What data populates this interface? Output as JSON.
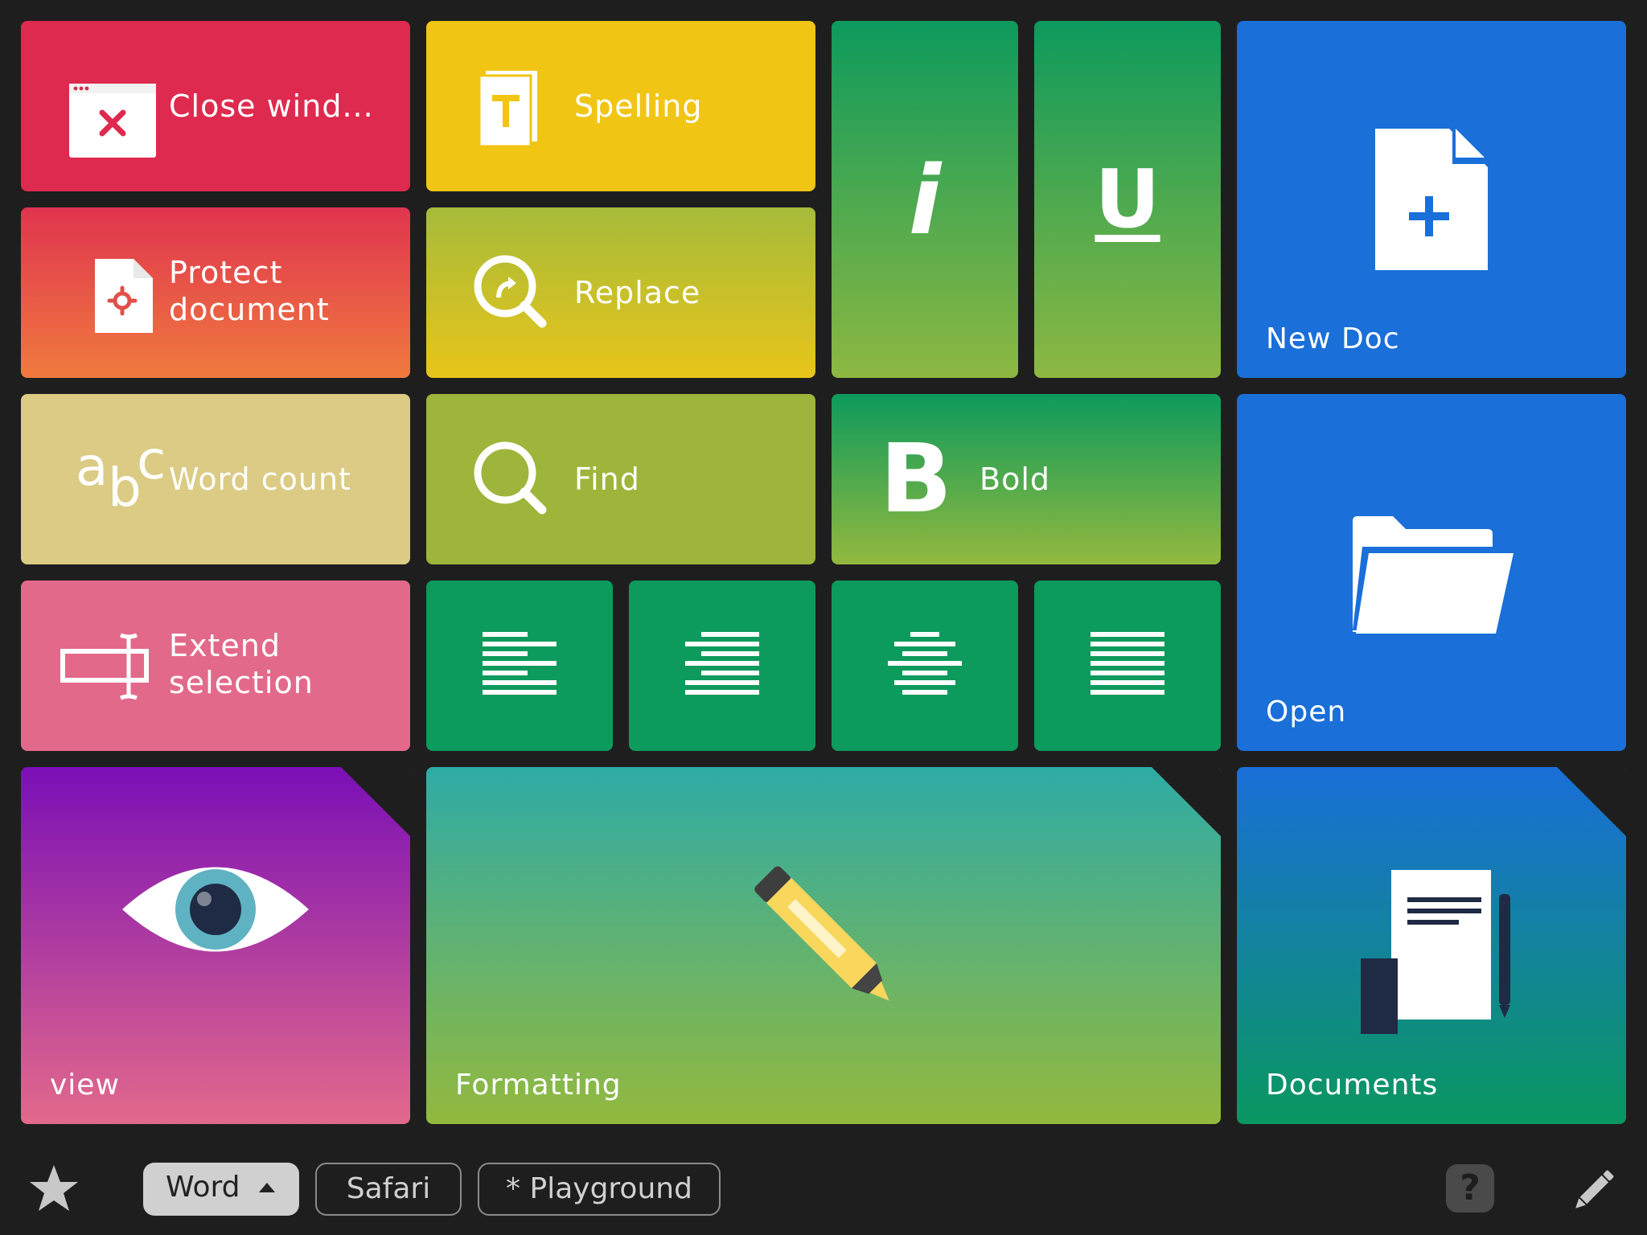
{
  "tiles": {
    "close_window": "Close wind...",
    "protect_document_line1": "Protect",
    "protect_document_line2": "document",
    "word_count": "Word count",
    "extend_selection_line1": "Extend",
    "extend_selection_line2": "selection",
    "spelling": "Spelling",
    "replace": "Replace",
    "find": "Find",
    "italic_glyph": "i",
    "underline_glyph": "U",
    "bold_glyph": "B",
    "bold": "Bold",
    "new_doc": "New Doc",
    "open": "Open",
    "view": "view",
    "formatting": "Formatting",
    "documents": "Documents",
    "abc_a": "a",
    "abc_b": "b",
    "abc_c": "c",
    "spelling_glyph": "T"
  },
  "bottom_bar": {
    "tabs": [
      {
        "label": "Word",
        "active": true
      },
      {
        "label": "Safari",
        "active": false
      },
      {
        "label": "* Playground",
        "active": false
      }
    ],
    "help_glyph": "?"
  },
  "colors": {
    "background": "#1e1e1e",
    "red": "#de2a4e",
    "yellow": "#f0c514",
    "olive": "#9db53a",
    "green": "#0d9a5d",
    "blue": "#1a6fd8",
    "beige": "#dbcb85",
    "pink": "#e3698b",
    "purple": "#7b10b6"
  }
}
